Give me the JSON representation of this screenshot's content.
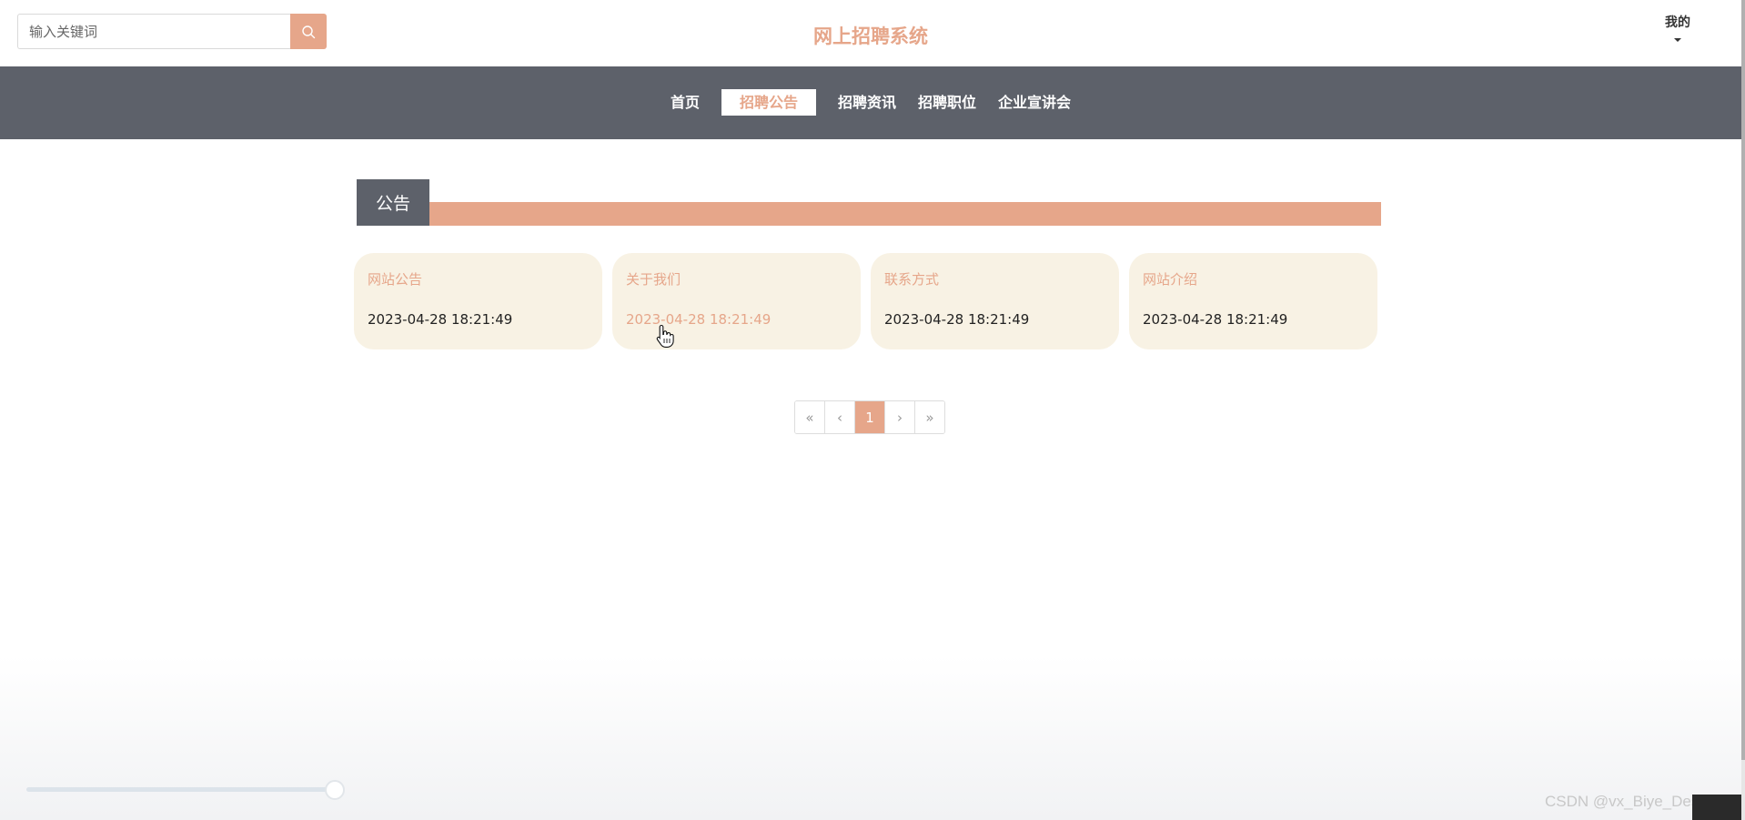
{
  "header": {
    "search_placeholder": "输入关键词",
    "site_title": "网上招聘系统",
    "user_menu_label": "我的"
  },
  "nav": {
    "items": [
      {
        "label": "首页",
        "active": false
      },
      {
        "label": "招聘公告",
        "active": true
      },
      {
        "label": "招聘资讯",
        "active": false
      },
      {
        "label": "招聘职位",
        "active": false
      },
      {
        "label": "企业宣讲会",
        "active": false
      }
    ]
  },
  "section": {
    "title": "公告"
  },
  "cards": [
    {
      "title": "网站公告",
      "date": "2023-04-28 18:21:49"
    },
    {
      "title": "关于我们",
      "date": "2023-04-28 18:21:49"
    },
    {
      "title": "联系方式",
      "date": "2023-04-28 18:21:49"
    },
    {
      "title": "网站介绍",
      "date": "2023-04-28 18:21:49"
    }
  ],
  "pagination": {
    "first": "«",
    "prev": "‹",
    "current": "1",
    "next": "›",
    "last": "»"
  },
  "watermark": "CSDN @vx_Biye_Design",
  "colors": {
    "accent": "#e6a68a",
    "nav_bg": "#5d616a",
    "card_bg": "#f8f2e4"
  },
  "icons": {
    "search": "search-icon",
    "user_caret": "caret-down-icon",
    "cursor": "hand-pointer-icon"
  }
}
